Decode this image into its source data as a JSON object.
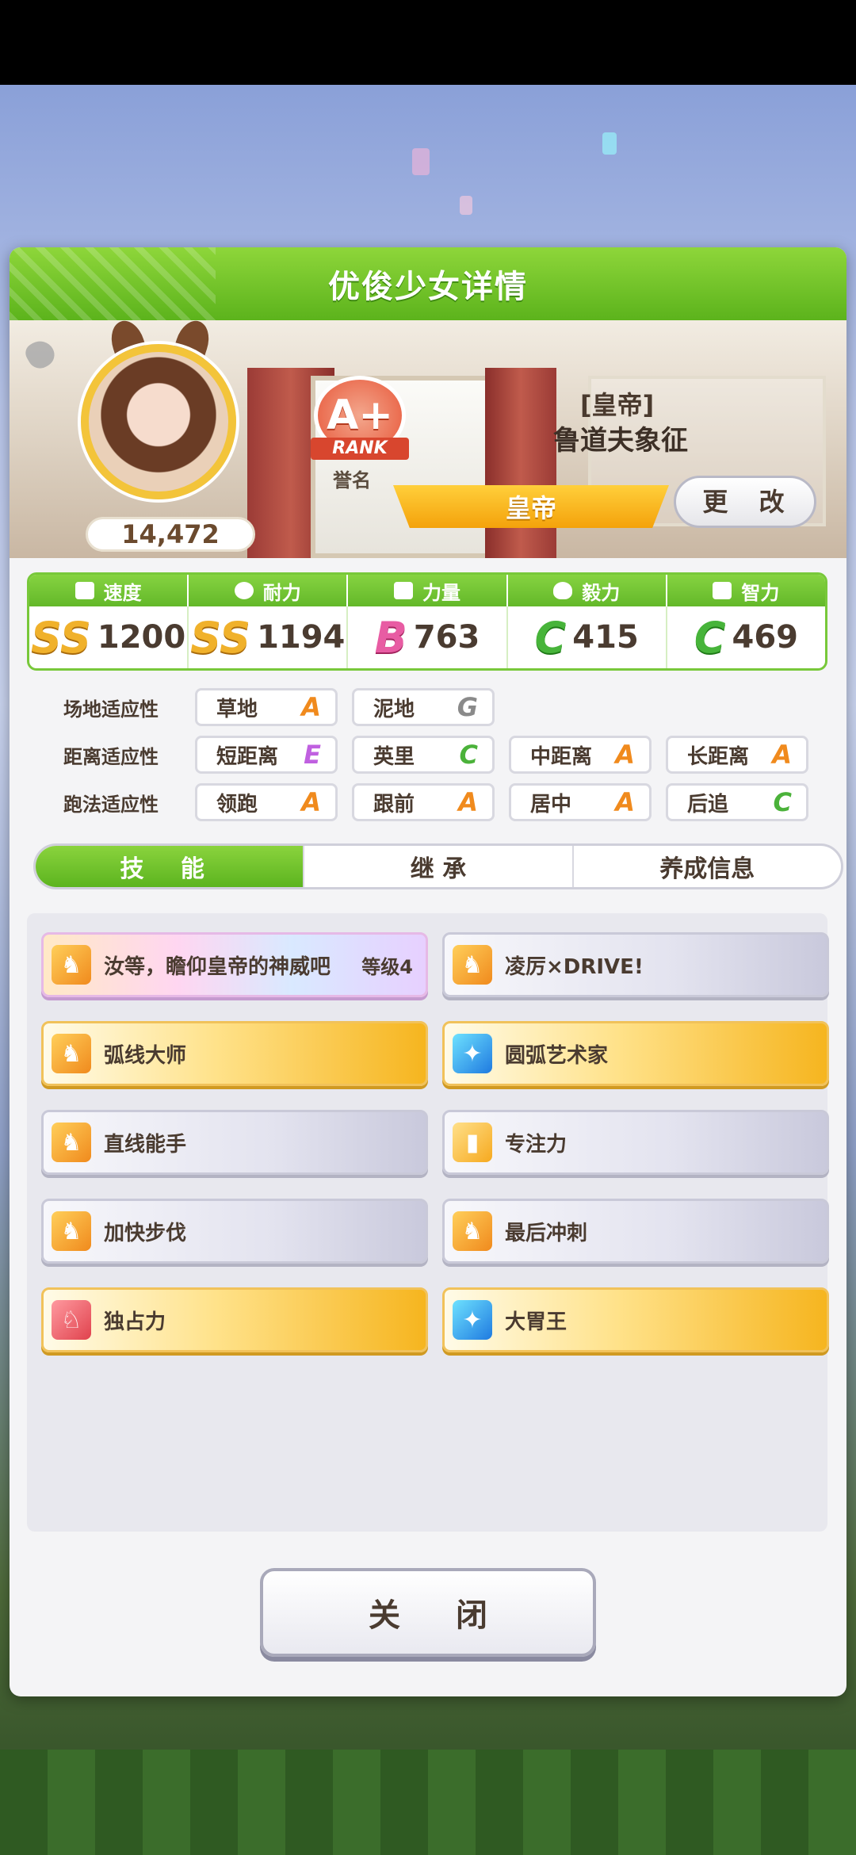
{
  "header": {
    "title": "优俊少女详情"
  },
  "profile": {
    "fans": "14,472",
    "rank_grade": "A+",
    "rank_label": "RANK",
    "title_caption": "誉名",
    "title_bracket": "[皇帝]",
    "name": "鲁道夫象征",
    "current_title": "皇帝",
    "change_label": "更 改"
  },
  "stats": [
    {
      "name": "速度",
      "grade": "SS",
      "value": "1200",
      "icon": "shoe-icon"
    },
    {
      "name": "耐力",
      "grade": "SS",
      "value": "1194",
      "icon": "heart-icon"
    },
    {
      "name": "力量",
      "grade": "B",
      "value": "763",
      "icon": "muscle-icon"
    },
    {
      "name": "毅力",
      "grade": "C",
      "value": "415",
      "icon": "flame-icon"
    },
    {
      "name": "智力",
      "grade": "C",
      "value": "469",
      "icon": "graduation-cap-icon"
    }
  ],
  "aptitude": {
    "track": {
      "label": "场地适应性",
      "items": [
        {
          "name": "草地",
          "grade": "A"
        },
        {
          "name": "泥地",
          "grade": "G"
        }
      ]
    },
    "distance": {
      "label": "距离适应性",
      "items": [
        {
          "name": "短距离",
          "grade": "E"
        },
        {
          "name": "英里",
          "grade": "C"
        },
        {
          "name": "中距离",
          "grade": "A"
        },
        {
          "name": "长距离",
          "grade": "A"
        }
      ]
    },
    "style": {
      "label": "跑法适应性",
      "items": [
        {
          "name": "领跑",
          "grade": "A"
        },
        {
          "name": "跟前",
          "grade": "A"
        },
        {
          "name": "居中",
          "grade": "A"
        },
        {
          "name": "后追",
          "grade": "C"
        }
      ]
    }
  },
  "tabs": [
    {
      "label": "技 能",
      "active": true
    },
    {
      "label": "继 承",
      "active": false
    },
    {
      "label": "养成信息",
      "active": false
    }
  ],
  "skills": [
    {
      "name": "汝等，瞻仰皇帝的神威吧",
      "level": "等级4",
      "style": "rainbow",
      "icon": "speed-horse-icon"
    },
    {
      "name": "凌厉×DRIVE!",
      "level": "",
      "style": "normal",
      "icon": "speed-horse-icon"
    },
    {
      "name": "弧线大师",
      "level": "",
      "style": "gold",
      "icon": "speed-horse-icon"
    },
    {
      "name": "圆弧艺术家",
      "level": "",
      "style": "gold",
      "icon": "sparkle-icon"
    },
    {
      "name": "直线能手",
      "level": "",
      "style": "normal",
      "icon": "speed-horse-icon"
    },
    {
      "name": "专注力",
      "level": "",
      "style": "normal",
      "icon": "focus-gate-icon"
    },
    {
      "name": "加快步伐",
      "level": "",
      "style": "normal",
      "icon": "speed-horse-icon"
    },
    {
      "name": "最后冲刺",
      "level": "",
      "style": "normal",
      "icon": "speed-horse-icon"
    },
    {
      "name": "独占力",
      "level": "",
      "style": "gold",
      "icon": "debuff-horse-icon"
    },
    {
      "name": "大胃王",
      "level": "",
      "style": "gold",
      "icon": "sparkle-icon"
    }
  ],
  "close_label": "关 闭"
}
